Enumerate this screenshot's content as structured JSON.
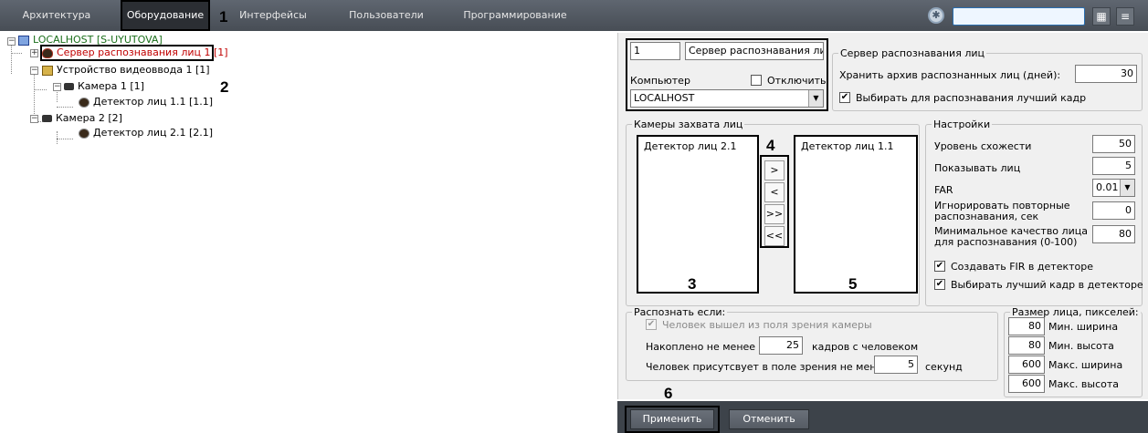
{
  "topbar": {
    "tabs": [
      "Архитектура",
      "Оборудование",
      "Интерфейсы",
      "Пользователи",
      "Программирование"
    ],
    "active_tab": "Оборудование",
    "search_value": ""
  },
  "annotations": [
    "1",
    "2",
    "3",
    "4",
    "5",
    "6"
  ],
  "tree": {
    "root": "LOCALHOST [S-UYUTOVA]",
    "server": "Сервер распознавания лиц 1 [1]",
    "video_device": "Устройство видеоввода 1 [1]",
    "camera1": "Камера 1 [1]",
    "detector1": "Детектор лиц 1.1 [1.1]",
    "camera2": "Камера 2 [2]",
    "detector2": "Детектор лиц 2.1 [2.1]"
  },
  "header": {
    "id": "1",
    "name": "Сервер распознавания лиц",
    "computer_label": "Компьютер",
    "disable_label": "Отключить",
    "disable_checked": false,
    "computer_value": "LOCALHOST"
  },
  "server_group": {
    "title": "Сервер распознавания лиц",
    "archive_label": "Хранить архив распознанных лиц (дней):",
    "archive_days": "30",
    "best_frame_label": "Выбирать для распознавания лучший кадр",
    "best_frame_checked": true
  },
  "cameras_group": {
    "title": "Камеры захвата лиц",
    "left_items": [
      "Детектор лиц 2.1"
    ],
    "right_items": [
      "Детектор лиц 1.1"
    ],
    "move_buttons": [
      ">",
      "<",
      ">>",
      "<<"
    ]
  },
  "settings_group": {
    "title": "Настройки",
    "similarity_label": "Уровень схожести",
    "similarity": "50",
    "show_faces_label": "Показывать лиц",
    "show_faces": "5",
    "far_label": "FAR",
    "far": "0.01",
    "ignore_label_1": "Игнорировать повторные",
    "ignore_label_2": "распознавания, сек",
    "ignore": "0",
    "min_quality_label_1": "Минимальное качество лица",
    "min_quality_label_2": "для распознавания (0-100)",
    "min_quality": "80",
    "create_fir_label": "Создавать FIR в детекторе",
    "create_fir_checked": true,
    "best_frame_det_label": "Выбирать лучший кадр в детекторе",
    "best_frame_det_checked": true
  },
  "recognize_group": {
    "title": "Распознать если:",
    "left_view_label": "Человек вышел из поля зрения камеры",
    "left_view_checked": true,
    "accum_prefix": "Накоплено не менее",
    "accum_value": "25",
    "accum_suffix": "кадров с человеком",
    "present_prefix": "Человек присутсвует в поле зрения не менее",
    "present_value": "5",
    "present_suffix": "секунд"
  },
  "size_group": {
    "title": "Размер лица, пикселей:",
    "min_width": "80",
    "min_width_label": "Мин. ширина",
    "min_height": "80",
    "min_height_label": "Мин. высота",
    "max_width": "600",
    "max_width_label": "Макс. ширина",
    "max_height": "600",
    "max_height_label": "Макс. высота"
  },
  "footer": {
    "apply_label": "Применить",
    "cancel_label": "Отменить"
  }
}
